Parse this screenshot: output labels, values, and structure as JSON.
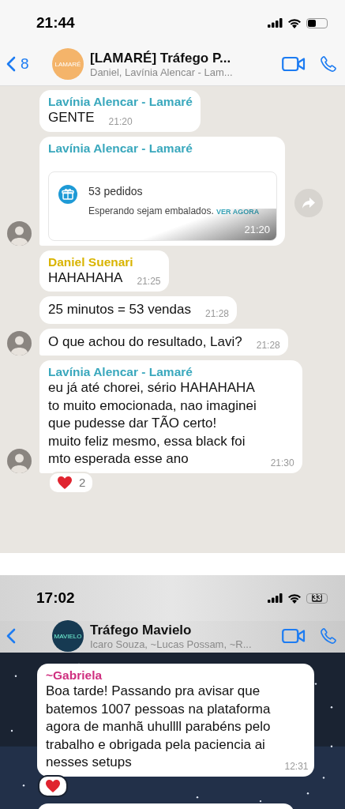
{
  "screens": [
    {
      "kind": "light",
      "status_bar": {
        "time": "21:44"
      },
      "header": {
        "back_count": "8",
        "avatar_text": "LAMARÉ",
        "title": "[LAMARÉ] Tráfego P...",
        "subtitle": "Daniel, Lavínia Alencar - Lam..."
      },
      "messages": [
        {
          "kind": "text",
          "sender": "Lavínia Alencar - Lamaré",
          "color": "#3aa8bd",
          "lines": [
            "GENTE"
          ],
          "time": "21:20",
          "avatar": false
        },
        {
          "kind": "order_card",
          "sender": "Lavínia Alencar - Lamaré",
          "color": "#3aa8bd",
          "card_title": "53 pedidos",
          "card_text": "Esperando sejam embalados.",
          "card_link": "VER AGORA",
          "time": "21:20",
          "avatar": true
        },
        {
          "kind": "text",
          "sender": "Daniel Suenari",
          "color": "#d9b400",
          "lines": [
            "HAHAHAHA"
          ],
          "time": "21:25",
          "avatar": false
        },
        {
          "kind": "text",
          "lines": [
            "25 minutos = 53 vendas"
          ],
          "time": "21:28",
          "avatar": false
        },
        {
          "kind": "text",
          "lines": [
            "O que achou do resultado, Lavi?"
          ],
          "time": "21:28",
          "avatar": true
        },
        {
          "kind": "text",
          "sender": "Lavínia Alencar - Lamaré",
          "color": "#3aa8bd",
          "lines": [
            "eu já até chorei, sério HAHAHAHA",
            "to muito emocionada, nao imaginei",
            "que pudesse dar TÃO certo!",
            "muito feliz mesmo, essa black foi",
            "mto esperada esse ano"
          ],
          "time": "21:30",
          "avatar": true,
          "reaction": {
            "kind": "heart",
            "count": "2"
          }
        }
      ]
    },
    {
      "kind": "dark",
      "status_bar": {
        "time": "17:02",
        "battery_text": "33"
      },
      "header": {
        "avatar_text": "MAVIELO",
        "title": "Tráfego Mavielo",
        "subtitle": "Icaro Souza, ~Lucas Possam, ~R..."
      },
      "messages": [
        {
          "kind": "text",
          "sender": "~Gabriela",
          "color": "#cf2f7f",
          "lines": [
            "Boa tarde! Passando pra avisar que",
            "batemos 1007 pessoas na plataforma",
            "agora de manhã uhullll parabéns pelo",
            "trabalho e obrigada pela paciencia ai",
            "nesses setups"
          ],
          "time": "12:31",
          "avatar": false,
          "reaction": {
            "kind": "heart"
          }
        },
        {
          "kind": "partial"
        }
      ]
    }
  ]
}
